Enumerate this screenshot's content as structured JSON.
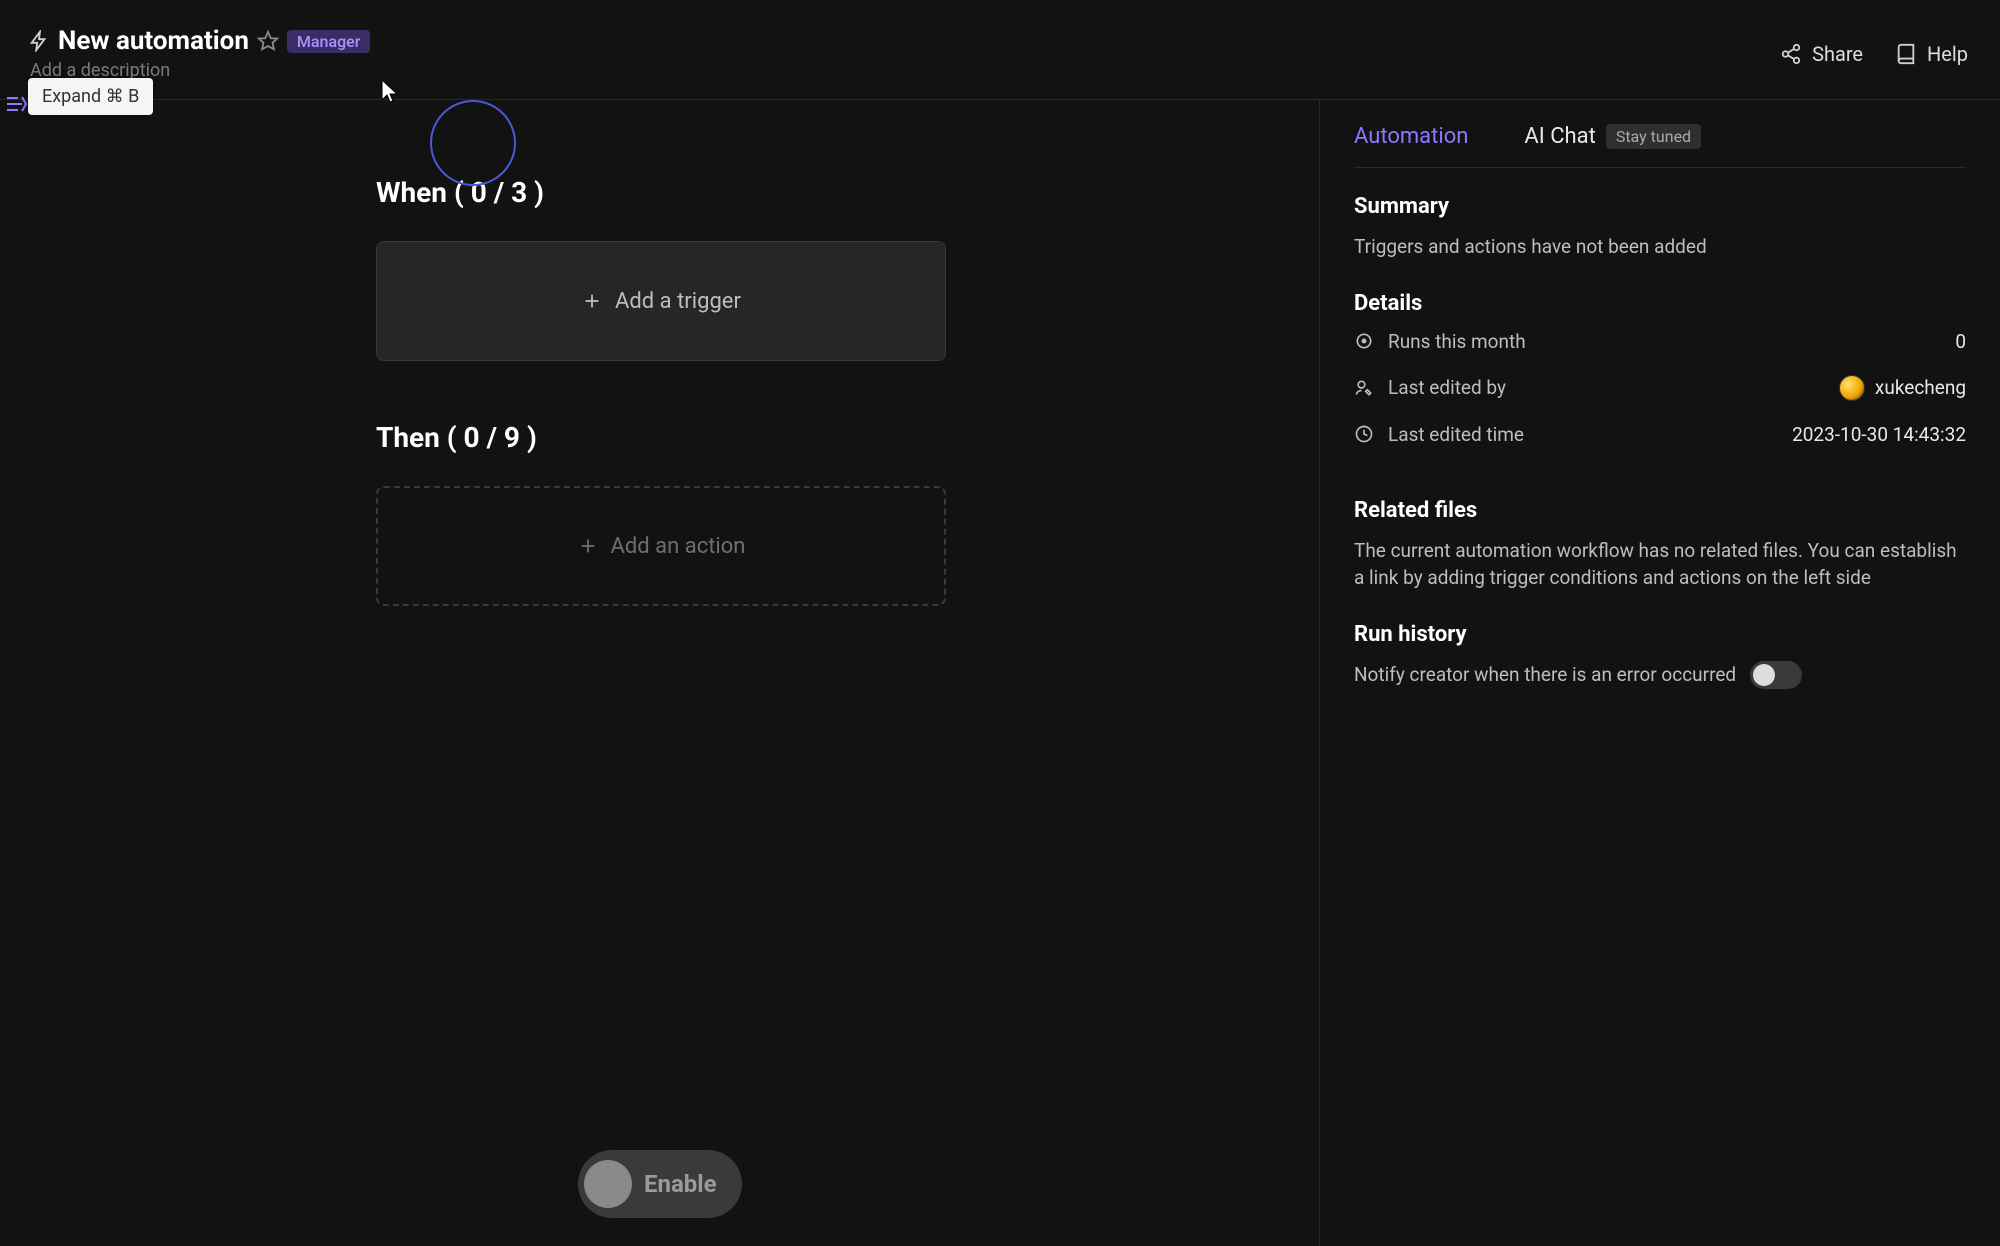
{
  "header": {
    "title": "New automation",
    "role_badge": "Manager",
    "desc_placeholder": "Add a description",
    "share_label": "Share",
    "help_label": "Help",
    "expand_tooltip": "Expand ⌘ B"
  },
  "canvas": {
    "when": {
      "heading": "When ( 0 / 3 )",
      "add_label": "Add a trigger"
    },
    "then": {
      "heading": "Then ( 0 / 9 )",
      "add_label": "Add an action"
    },
    "enable_label": "Enable"
  },
  "panel": {
    "tabs": {
      "automation": "Automation",
      "ai_chat": "AI Chat",
      "ai_chat_badge": "Stay tuned"
    },
    "summary": {
      "heading": "Summary",
      "text": "Triggers and actions have not been added"
    },
    "details": {
      "heading": "Details",
      "runs_label": "Runs this month",
      "runs_value": "0",
      "edited_by_label": "Last edited by",
      "edited_by_value": "xukecheng",
      "edited_time_label": "Last edited time",
      "edited_time_value": "2023-10-30 14:43:32"
    },
    "related": {
      "heading": "Related files",
      "text": "The current automation workflow has no related files. You can establish a link by adding trigger conditions and actions on the left side"
    },
    "run_history": {
      "heading": "Run history",
      "notify_label": "Notify creator when there is an error occurred"
    }
  }
}
